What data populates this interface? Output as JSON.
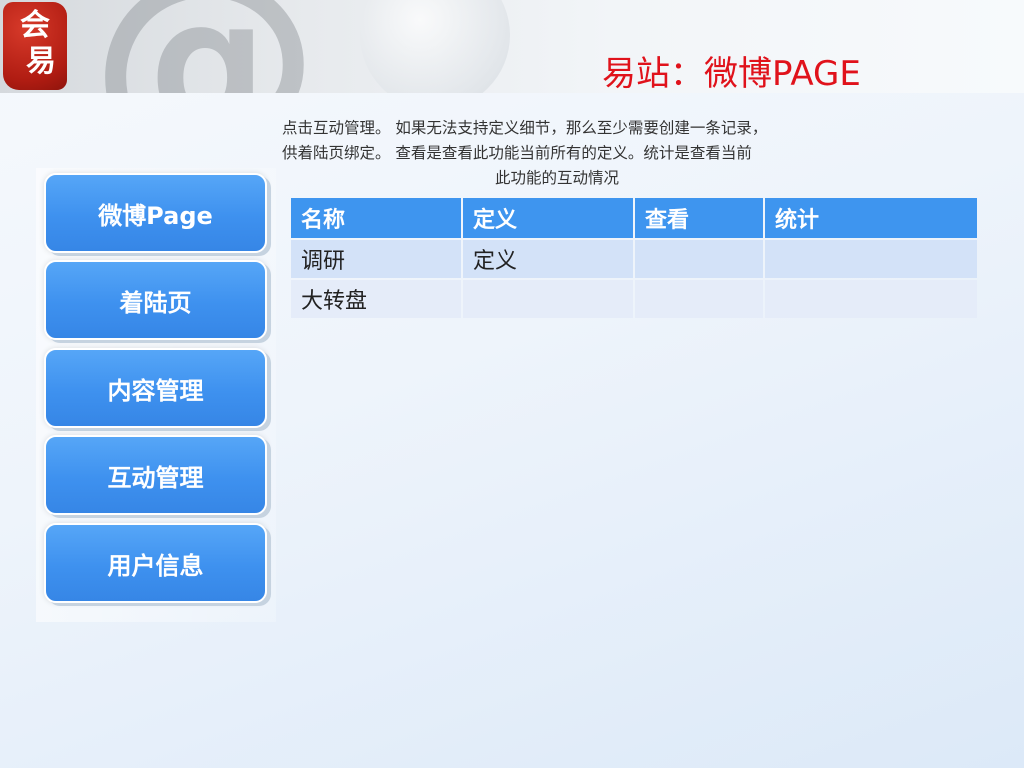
{
  "header": {
    "logo_chars": [
      "会",
      "易"
    ],
    "title": "易站：微博PAGE"
  },
  "description": {
    "lines": [
      "点击互动管理。 如果无法支持定义细节，那么至少需要创建一条记录，",
      "供着陆页绑定。 查看是查看此功能当前所有的定义。统计是查看当前",
      "此功能的互动情况"
    ]
  },
  "sidebar": {
    "items": [
      {
        "label": "微博Page"
      },
      {
        "label": "着陆页"
      },
      {
        "label": "内容管理"
      },
      {
        "label": "互动管理"
      },
      {
        "label": "用户信息"
      }
    ]
  },
  "table": {
    "headers": [
      "名称",
      "定义",
      "查看",
      "统计"
    ],
    "rows": [
      [
        "调研",
        "定义",
        "",
        ""
      ],
      [
        "大转盘",
        "",
        "",
        ""
      ]
    ]
  },
  "colors": {
    "title_red": "#e0121b",
    "nav_blue": "#3e91ef",
    "table_header": "#3e95ef",
    "row_a": "#d3e2f8",
    "row_b": "#e5ecf9"
  },
  "icons": {
    "logo": "hui-yi-logo",
    "header_decoration": "at-sign-icon"
  }
}
